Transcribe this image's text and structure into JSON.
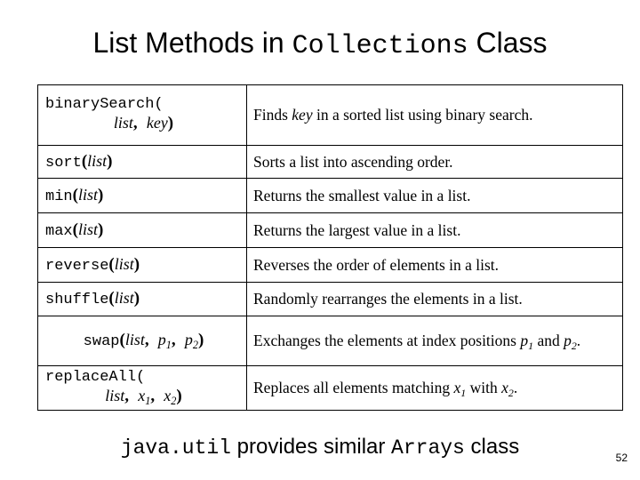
{
  "slide": {
    "title_prefix": "List Methods in ",
    "title_mono": "Collections",
    "title_suffix": " Class",
    "page_number": "52"
  },
  "footer": {
    "mono_1": "java.util",
    "text_1": " provides similar ",
    "mono_2": "Arrays",
    "text_2": " class"
  },
  "table": {
    "rows": [
      {
        "sig_name": "binarySearch",
        "sig_open": "(",
        "sig_args_line2": "list, key)",
        "sig_full": "binarySearch(list, key)",
        "two_line": true,
        "desc_before": "Finds ",
        "desc_italic": "key",
        "desc_after": " in a sorted list using binary search.",
        "desc_full": "Finds key in a sorted list using binary search."
      },
      {
        "sig_name": "sort",
        "sig_open": "(",
        "sig_arg": "list",
        "sig_close": ")",
        "sig_full": "sort(list)",
        "two_line": false,
        "desc_full": "Sorts a list into ascending order."
      },
      {
        "sig_name": "min",
        "sig_open": "(",
        "sig_arg": "list",
        "sig_close": ")",
        "sig_full": "min(list)",
        "two_line": false,
        "desc_full": "Returns the smallest value in a list."
      },
      {
        "sig_name": "max",
        "sig_open": "(",
        "sig_arg": "list",
        "sig_close": ")",
        "sig_full": "max(list)",
        "two_line": false,
        "desc_full": "Returns the largest value in a list."
      },
      {
        "sig_name": "reverse",
        "sig_open": "(",
        "sig_arg": "list",
        "sig_close": ")",
        "sig_full": "reverse(list)",
        "two_line": false,
        "desc_full": "Reverses the order of elements in a list."
      },
      {
        "sig_name": "shuffle",
        "sig_open": "(",
        "sig_arg": "list",
        "sig_close": ")",
        "sig_full": "shuffle(list)",
        "two_line": false,
        "desc_full": "Randomly rearranges the elements in a list."
      },
      {
        "sig_name": "swap",
        "sig_open": "(",
        "sig_arg": "list, p1, p2",
        "sig_close": ")",
        "sig_full": "swap(list, p1, p2)",
        "two_line": false,
        "desc_full": "Exchanges the elements at index positions p1 and p2."
      },
      {
        "sig_name": "replaceAll",
        "sig_open": "(",
        "sig_args_line2": "list, x1, x2)",
        "sig_full": "replaceAll(list, x1, x2)",
        "two_line": true,
        "desc_full": "Replaces all elements matching x1 with x2."
      }
    ]
  }
}
